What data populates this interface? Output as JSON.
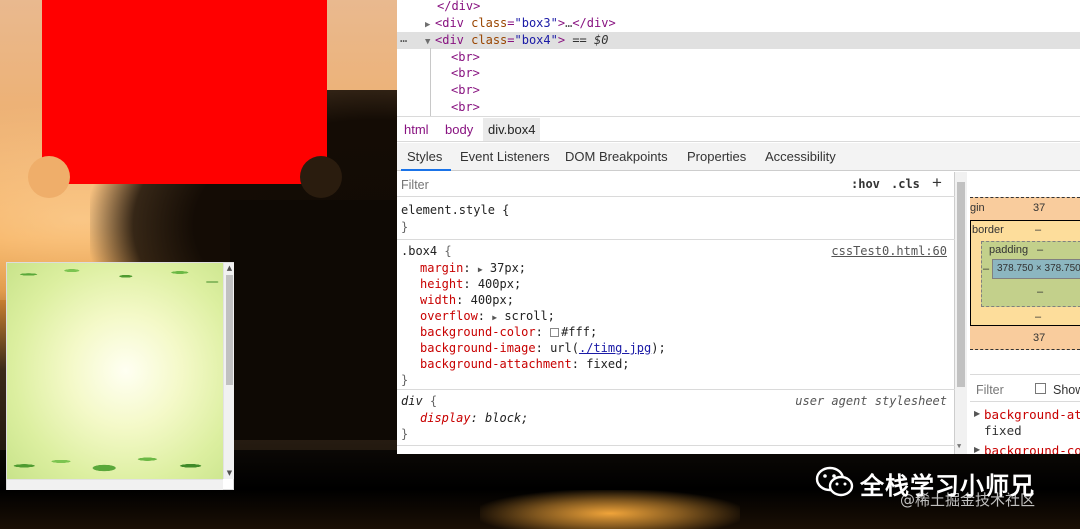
{
  "dom_tree": {
    "lines": [
      {
        "pre": "</div>",
        "tri": ""
      },
      {
        "tag_open": "<div",
        "attr": "class",
        "val": "\"box3\"",
        "close": ">",
        "dots": "…",
        "end": "</div>",
        "tri": "▶"
      },
      {
        "tag_open": "<div",
        "attr": "class",
        "val": "\"box4\"",
        "close": ">",
        "eq": "== $0",
        "tri": "▼",
        "gutter": "…"
      },
      {
        "pre": "<br>"
      },
      {
        "pre": "<br>"
      },
      {
        "pre": "<br>"
      },
      {
        "pre": "<br>"
      }
    ]
  },
  "breadcrumb": [
    "html",
    "body",
    "div.box4"
  ],
  "tabs": [
    "Styles",
    "Event Listeners",
    "DOM Breakpoints",
    "Properties",
    "Accessibility"
  ],
  "filter": {
    "placeholder": "Filter",
    "hov": ":hov",
    "cls": ".cls",
    "plus": "+"
  },
  "rules": {
    "element_style": {
      "selector": "element.style {",
      "close": "}"
    },
    "box4": {
      "selector": ".box4",
      "open": "{",
      "source": "cssTest0.html:60",
      "close": "}",
      "props": [
        {
          "name": "margin",
          "sep": ":",
          "arrow": true,
          "value": "37px;"
        },
        {
          "name": "height",
          "sep": ":",
          "value": "400px;"
        },
        {
          "name": "width",
          "sep": ":",
          "value": "400px;"
        },
        {
          "name": "overflow",
          "sep": ":",
          "arrow": true,
          "value": "scroll;"
        },
        {
          "name": "background-color",
          "sep": ":",
          "swatch": "#ffffff",
          "value": "#fff;"
        },
        {
          "name": "background-image",
          "sep": ":",
          "pre": "url(",
          "link": "./timg.jpg",
          "post": ");"
        },
        {
          "name": "background-attachment",
          "sep": ":",
          "value": "fixed;"
        }
      ]
    },
    "div": {
      "selector": "div",
      "open": "{",
      "source": "user agent stylesheet",
      "prop": "display",
      "value": "block;",
      "close": "}"
    }
  },
  "box_model": {
    "margin_label": "gin",
    "margin_top": "37",
    "border_label": "border",
    "border_value": "–",
    "padding_label": "padding",
    "padding_value": "–",
    "content_left": "–",
    "content": "378.750 × 378.750",
    "padding_bottom": "–",
    "border_bottom": "–",
    "margin_bottom": "37"
  },
  "computed": {
    "filter_placeholder": "Filter",
    "show_label": "Show",
    "prop1": "background-att",
    "prop1_value": "fixed",
    "prop2": "background-col"
  },
  "watermark": {
    "title": "全栈学习小师兄",
    "sub": "@稀土掘金技术社区"
  },
  "colors": {
    "red_box": "#ff0000",
    "selected_row": "#e0e0e0",
    "tab_accent": "#1a73e8"
  }
}
